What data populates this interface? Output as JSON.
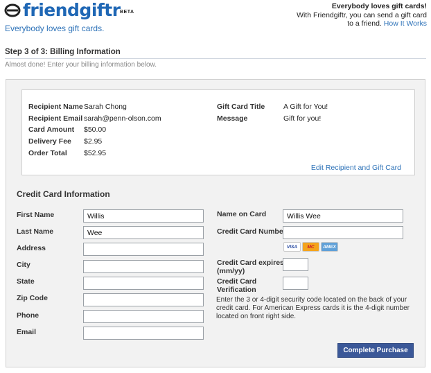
{
  "brand": {
    "name": "friendgiftr",
    "beta": "BETA",
    "tagline": "Everybody loves gift cards."
  },
  "header_right": {
    "headline": "Everybody loves gift cards!",
    "line1": "With Friendgiftr, you can send a gift card",
    "line2": "to a friend.",
    "link": "How It Works"
  },
  "step": {
    "title": "Step 3 of 3: Billing Information",
    "subtitle": "Almost done! Enter your billing information below."
  },
  "summary": {
    "left": [
      {
        "label": "Recipient Name",
        "value": "Sarah Chong"
      },
      {
        "label": "Recipient Email",
        "value": "sarah@penn-olson.com"
      },
      {
        "label": "Card Amount",
        "value": "$50.00"
      },
      {
        "label": "Delivery Fee",
        "value": "$2.95"
      },
      {
        "label": "Order Total",
        "value": "$52.95"
      }
    ],
    "right": [
      {
        "label": "Gift Card Title",
        "value": "A Gift for You!"
      },
      {
        "label": "Message",
        "value": "Gift for you!"
      }
    ],
    "edit_link": "Edit Recipient and Gift Card"
  },
  "cc": {
    "title": "Credit Card Information",
    "left_fields": [
      {
        "label": "First Name",
        "value": "Willis"
      },
      {
        "label": "Last Name",
        "value": "Wee"
      },
      {
        "label": "Address",
        "value": ""
      },
      {
        "label": "City",
        "value": ""
      },
      {
        "label": "State",
        "value": ""
      },
      {
        "label": "Zip Code",
        "value": ""
      },
      {
        "label": "Phone",
        "value": ""
      },
      {
        "label": "Email",
        "value": ""
      }
    ],
    "name_on_card": {
      "label": "Name on Card",
      "value": "Willis Wee"
    },
    "card_number": {
      "label": "Credit Card Number",
      "value": ""
    },
    "card_logos": [
      "VISA",
      "MC",
      "AMEX"
    ],
    "expires": {
      "label1": "Credit Card expires",
      "label2": "(mm/yy)",
      "value": ""
    },
    "verification": {
      "label1": "Credit Card",
      "label2": "Verification",
      "value": ""
    },
    "note": "Enter the 3 or 4-digit security code located on the back of your credit card. For American Express cards it is the 4-digit number located on front right side.",
    "submit": "Complete Purchase"
  },
  "colors": {
    "brand_blue": "#1f67b5",
    "button_blue": "#3b5898",
    "link_blue": "#2d72b8"
  }
}
